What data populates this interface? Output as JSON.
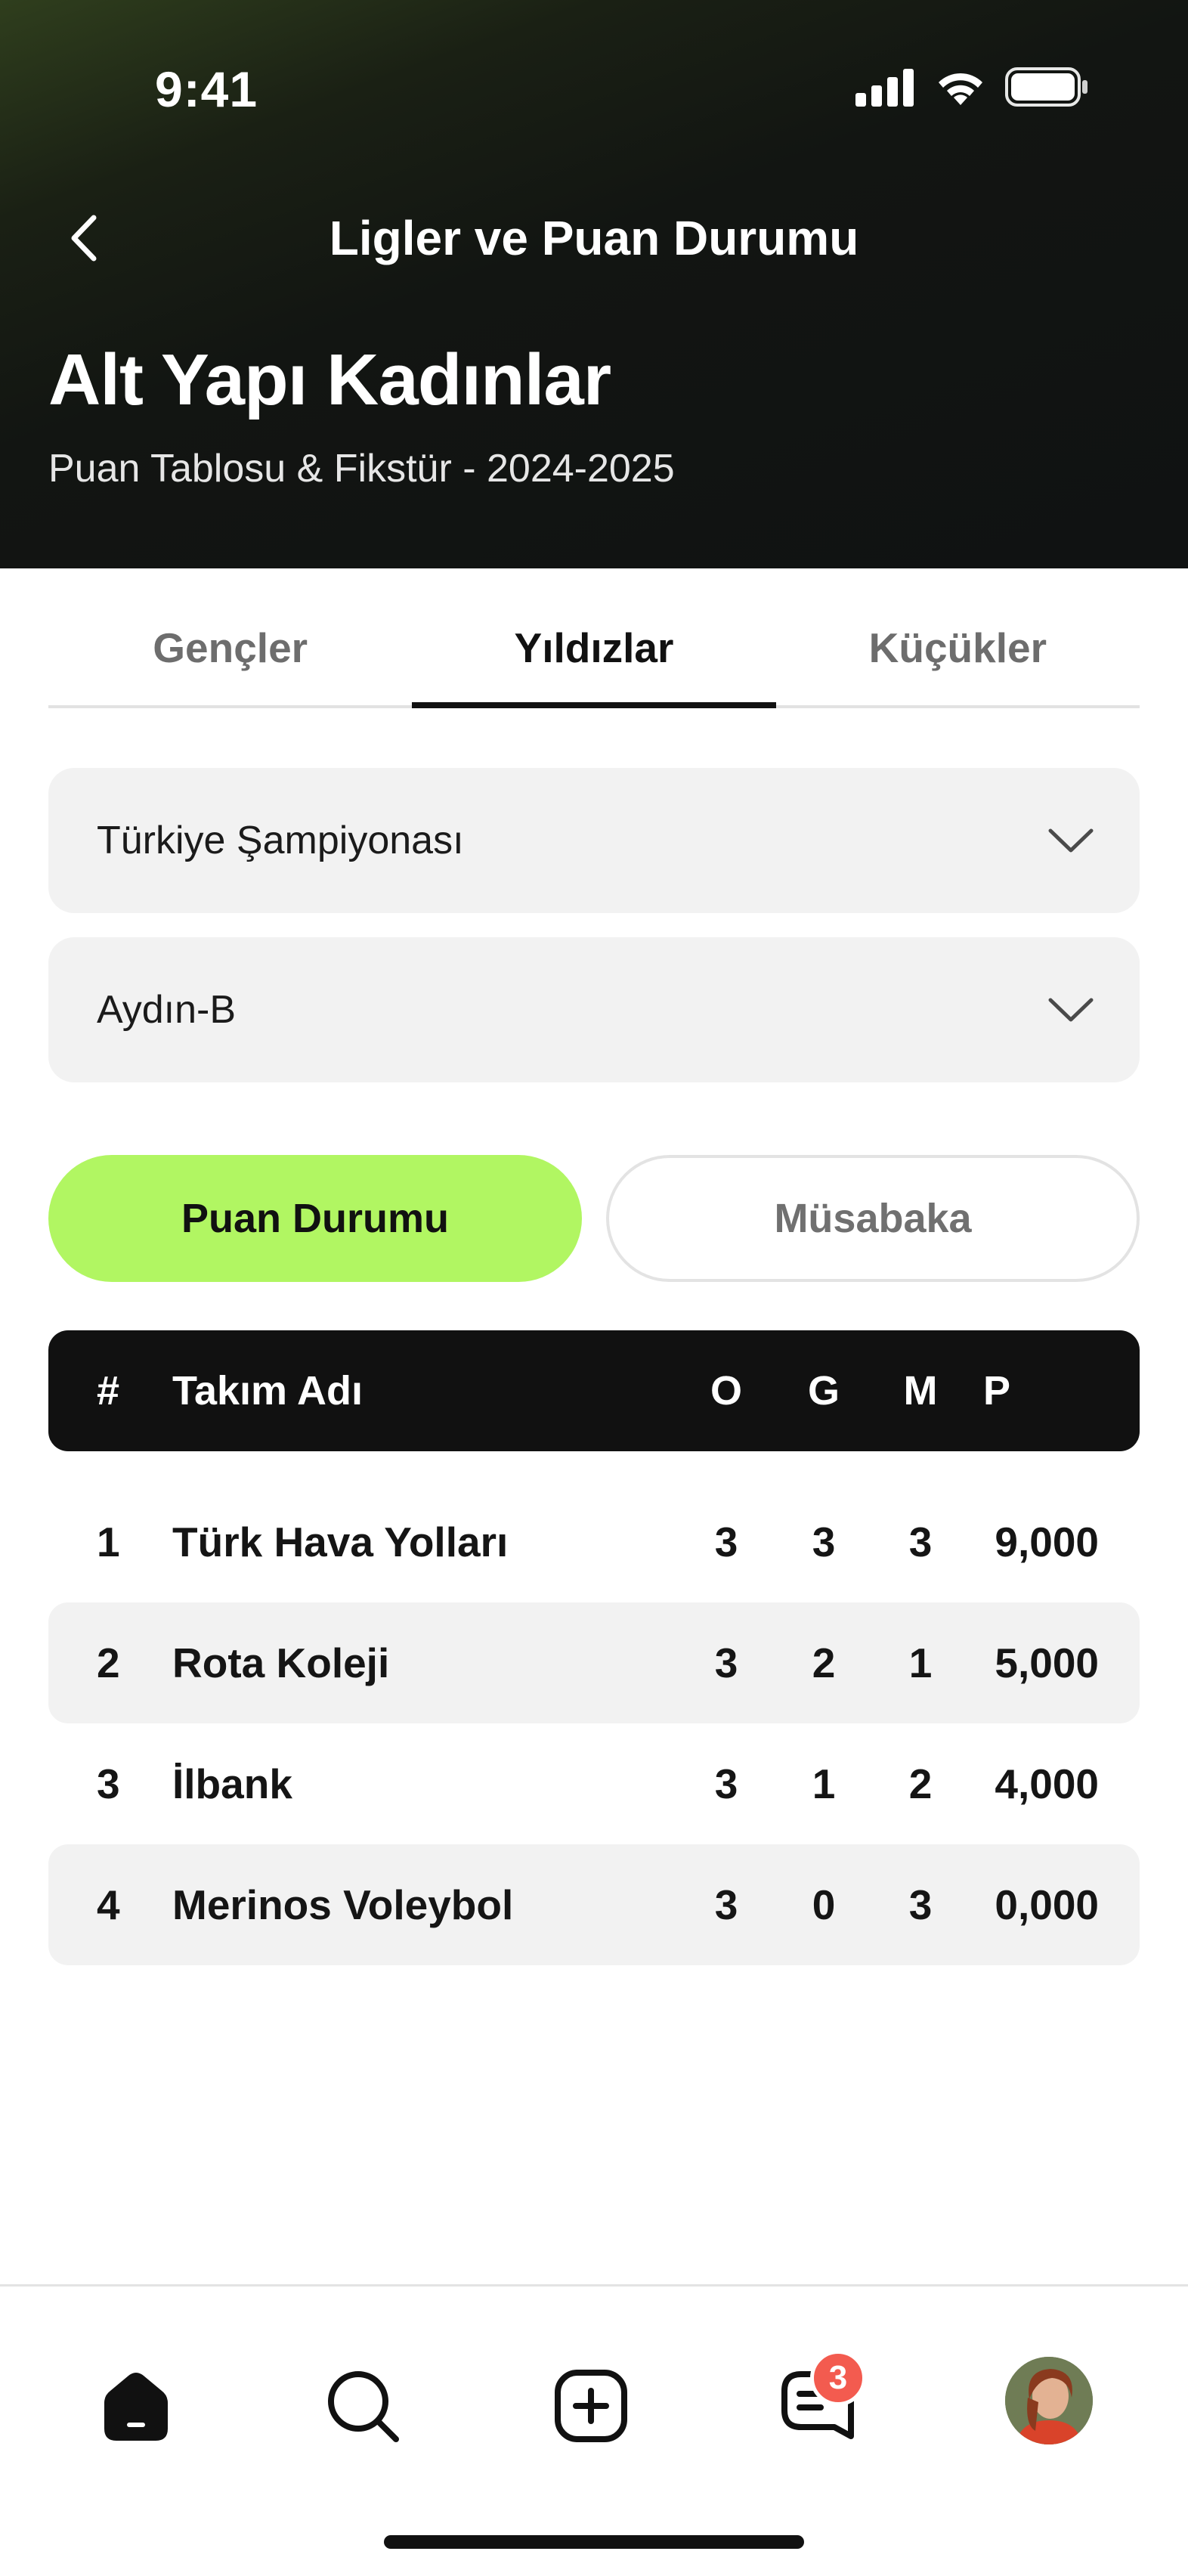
{
  "status_bar": {
    "time": "9:41"
  },
  "header": {
    "nav_title": "Ligler ve Puan Durumu",
    "title": "Alt Yapı Kadınlar",
    "subtitle": "Puan Tablosu & Fikstür - 2024-2025"
  },
  "tabs": [
    {
      "label": "Gençler",
      "active": false
    },
    {
      "label": "Yıldızlar",
      "active": true
    },
    {
      "label": "Küçükler",
      "active": false
    }
  ],
  "filters": {
    "championship": "Türkiye Şampiyonası",
    "group": "Aydın-B"
  },
  "segments": {
    "standings": "Puan Durumu",
    "matches": "Müsabaka"
  },
  "table": {
    "headers": {
      "rank": "#",
      "team": "Takım Adı",
      "o": "O",
      "g": "G",
      "m": "M",
      "p": "P"
    },
    "rows": [
      {
        "rank": "1",
        "team": "Türk Hava Yolları",
        "o": "3",
        "g": "3",
        "m": "3",
        "p": "9,000"
      },
      {
        "rank": "2",
        "team": "Rota Koleji",
        "o": "3",
        "g": "2",
        "m": "1",
        "p": "5,000"
      },
      {
        "rank": "3",
        "team": "İlbank",
        "o": "3",
        "g": "1",
        "m": "2",
        "p": "4,000"
      },
      {
        "rank": "4",
        "team": "Merinos Voleybol",
        "o": "3",
        "g": "0",
        "m": "3",
        "p": "0,000"
      }
    ]
  },
  "bottom_nav": {
    "items": [
      "home-icon",
      "search-icon",
      "add-icon",
      "messages-icon",
      "profile-avatar"
    ],
    "messages_badge": "3"
  },
  "colors": {
    "accent": "#b1f662",
    "header_bg": "#121512",
    "badge": "#f35b4f"
  }
}
